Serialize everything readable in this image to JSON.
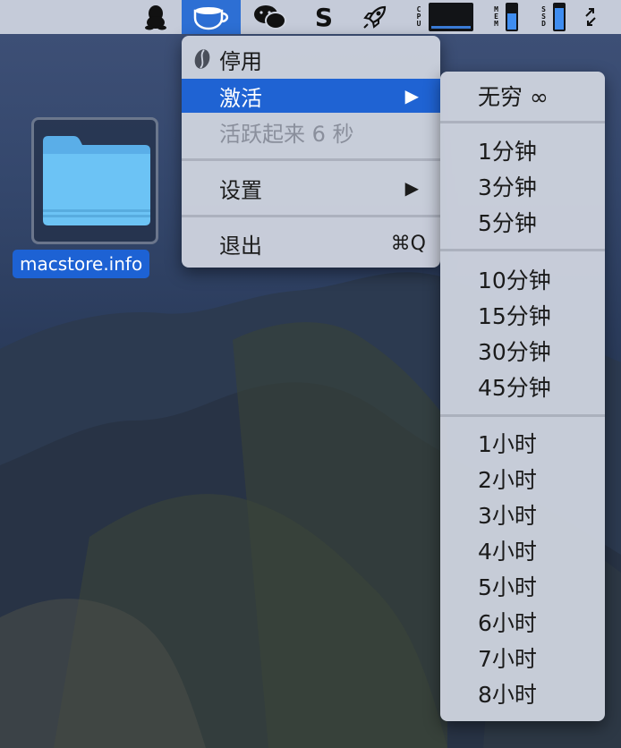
{
  "menubar": {
    "icons": [
      "qq-icon",
      "coffee-cup-icon",
      "wechat-icon",
      "s-app-icon",
      "rocket-icon",
      "cpu-meter",
      "mem-meter",
      "ssd-meter",
      "resize-arrows-icon"
    ],
    "cpu_label": "CPU",
    "mem_label": "MEM",
    "ssd_label": "SSD",
    "active_color": "#2d6fd4"
  },
  "desktop": {
    "file_label": "macstore.info"
  },
  "main_menu": {
    "items": [
      {
        "label": "停用",
        "state": "normal"
      },
      {
        "label": "激活",
        "state": "highlighted",
        "submenu": true
      },
      {
        "label": "活跃起来 6 秒",
        "state": "disabled"
      },
      {
        "label": "设置",
        "state": "normal",
        "submenu": true
      },
      {
        "label": "退出",
        "state": "normal",
        "shortcut": "⌘Q"
      }
    ]
  },
  "submenu": {
    "items": [
      "无穷 ∞",
      "1分钟",
      "3分钟",
      "5分钟",
      "10分钟",
      "15分钟",
      "30分钟",
      "45分钟",
      "1小时",
      "2小时",
      "3小时",
      "4小时",
      "5小时",
      "6小时",
      "7小时",
      "8小时"
    ]
  },
  "colors": {
    "highlight": "#1f63d3",
    "folder": "#5fb8f2"
  }
}
